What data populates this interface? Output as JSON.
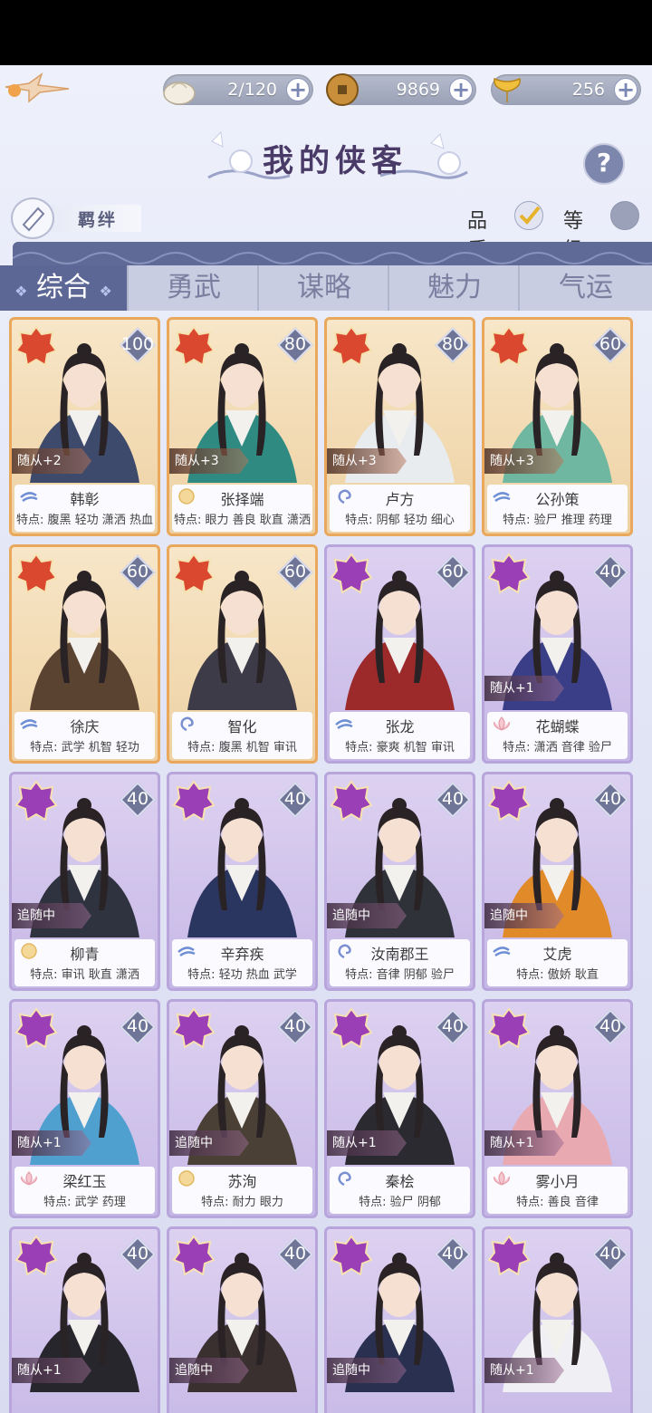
{
  "resources": [
    {
      "icon": "steamed-bun-icon",
      "value": "2/120"
    },
    {
      "icon": "copper-coin-icon",
      "value": "9869"
    },
    {
      "icon": "ginkgo-leaf-icon",
      "value": "256"
    }
  ],
  "title": "我的侠客",
  "bond_label": "羁绊",
  "sort": {
    "quality": "品质",
    "level": "等级"
  },
  "tabs": [
    "综合",
    "勇武",
    "谋略",
    "魅力",
    "气运"
  ],
  "cards": [
    {
      "name": "韩彰",
      "level": "100",
      "rarity": "gold",
      "follow": "随从+2",
      "traits": "特点: 腹黑 轻功 潇洒 热血",
      "icon": "wind-icon",
      "color": "#3d4a6b"
    },
    {
      "name": "张择端",
      "level": "80",
      "rarity": "gold",
      "follow": "随从+3",
      "traits": "特点: 眼力 善良 耿直 潇洒",
      "icon": "sun-icon",
      "color": "#2f8a82"
    },
    {
      "name": "卢方",
      "level": "80",
      "rarity": "gold",
      "follow": "随从+3",
      "traits": "特点: 阴郁 轻功 细心",
      "icon": "swirl-icon",
      "color": "#e8ecef"
    },
    {
      "name": "公孙策",
      "level": "60",
      "rarity": "gold",
      "follow": "随从+3",
      "traits": "特点: 验尸 推理 药理",
      "icon": "wind-icon",
      "color": "#6fb7a1"
    },
    {
      "name": "徐庆",
      "level": "60",
      "rarity": "gold",
      "follow": "",
      "traits": "特点: 武学 机智 轻功",
      "icon": "wind-icon",
      "color": "#5b4332"
    },
    {
      "name": "智化",
      "level": "60",
      "rarity": "gold",
      "follow": "",
      "traits": "特点: 腹黑 机智 审讯",
      "icon": "swirl-icon",
      "color": "#3e3b48"
    },
    {
      "name": "张龙",
      "level": "60",
      "rarity": "purple",
      "follow": "",
      "traits": "特点: 豪爽 机智 审讯",
      "icon": "wind-icon",
      "color": "#9c2a2a"
    },
    {
      "name": "花蝴蝶",
      "level": "40",
      "rarity": "purple",
      "follow": "随从+1",
      "traits": "特点: 潇洒 音律 验尸",
      "icon": "lotus-icon",
      "color": "#3a3e86"
    },
    {
      "name": "柳青",
      "level": "40",
      "rarity": "purple",
      "follow": "追随中",
      "traits": "特点: 审讯 耿直 潇洒",
      "icon": "sun-icon",
      "color": "#2f3340"
    },
    {
      "name": "辛弃疾",
      "level": "40",
      "rarity": "purple",
      "follow": "",
      "traits": "特点: 轻功 热血 武学",
      "icon": "wind-icon",
      "color": "#2b3660"
    },
    {
      "name": "汝南郡王",
      "level": "40",
      "rarity": "purple",
      "follow": "追随中",
      "traits": "特点: 音律 阴郁 验尸",
      "icon": "swirl-icon",
      "color": "#2f3238"
    },
    {
      "name": "艾虎",
      "level": "40",
      "rarity": "purple",
      "follow": "追随中",
      "traits": "特点: 傲娇 耿直",
      "icon": "wind-icon",
      "color": "#e08a2a"
    },
    {
      "name": "梁红玉",
      "level": "40",
      "rarity": "purple",
      "follow": "随从+1",
      "traits": "特点: 武学 药理",
      "icon": "lotus-icon",
      "color": "#4f9fcf"
    },
    {
      "name": "苏洵",
      "level": "40",
      "rarity": "purple",
      "follow": "追随中",
      "traits": "特点: 耐力 眼力",
      "icon": "sun-icon",
      "color": "#4a4036"
    },
    {
      "name": "秦桧",
      "level": "40",
      "rarity": "purple",
      "follow": "随从+1",
      "traits": "特点: 验尸 阴郁",
      "icon": "swirl-icon",
      "color": "#2a2a30"
    },
    {
      "name": "雾小月",
      "level": "40",
      "rarity": "purple",
      "follow": "随从+1",
      "traits": "特点: 善良 音律",
      "icon": "lotus-icon",
      "color": "#e8a9b0"
    },
    {
      "name": "",
      "level": "40",
      "rarity": "purple",
      "follow": "随从+1",
      "traits": "",
      "icon": "",
      "color": "#26262c"
    },
    {
      "name": "",
      "level": "40",
      "rarity": "purple",
      "follow": "追随中",
      "traits": "",
      "icon": "",
      "color": "#3a3030"
    },
    {
      "name": "",
      "level": "40",
      "rarity": "purple",
      "follow": "追随中",
      "traits": "",
      "icon": "",
      "color": "#2a3050"
    },
    {
      "name": "",
      "level": "40",
      "rarity": "purple",
      "follow": "随从+1",
      "traits": "",
      "icon": "",
      "color": "#f0f0f4"
    }
  ]
}
